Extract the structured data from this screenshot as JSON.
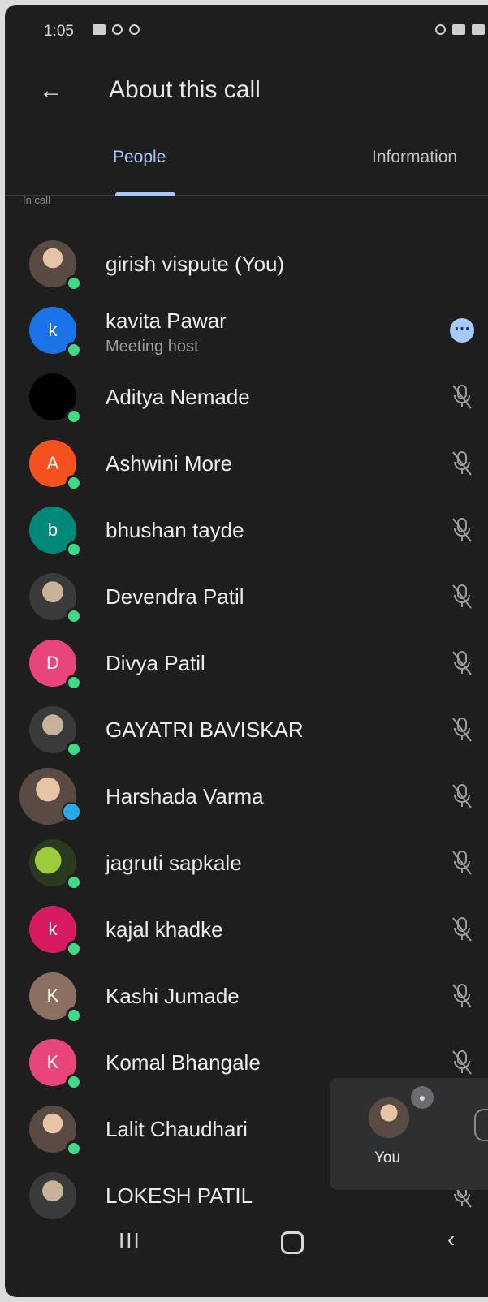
{
  "status_bar": {
    "time": "1:05"
  },
  "app_bar": {
    "back_icon": "arrow-left-icon",
    "title": "About this call"
  },
  "tabs": [
    {
      "label": "People",
      "selected": true
    },
    {
      "label": "Information",
      "selected": false
    }
  ],
  "section_label": "In call",
  "participants": [
    {
      "name": "girish vispute (You)",
      "avatar": "photo",
      "avatar_type": "photo"
    },
    {
      "name": "kavita Pawar",
      "subtitle": "Meeting host",
      "avatar_letter": "k",
      "avatar_color": "#1a73e8",
      "action": "more-options"
    },
    {
      "name": "Aditya Nemade",
      "avatar_color": "#000000",
      "status": "muted"
    },
    {
      "name": "Ashwini More",
      "avatar_letter": "A",
      "avatar_color": "#f4511e",
      "status": "muted"
    },
    {
      "name": "bhushan tayde",
      "avatar_letter": "b",
      "avatar_color": "#00897b",
      "status": "muted"
    },
    {
      "name": "Devendra Patil",
      "avatar_type": "photo",
      "status": "muted"
    },
    {
      "name": "Divya Patil",
      "avatar_letter": "D",
      "avatar_color": "#e8457a",
      "status": "muted"
    },
    {
      "name": "GAYATRI BAVISKAR",
      "avatar_type": "photo",
      "status": "muted"
    },
    {
      "name": "Harshada Varma",
      "avatar_type": "photo",
      "status": "muted"
    },
    {
      "name": "jagruti sapkale",
      "avatar_type": "photo",
      "status": "muted"
    },
    {
      "name": "kajal khadke",
      "avatar_letter": "k",
      "avatar_color": "#d81b60",
      "status": "muted"
    },
    {
      "name": "Kashi Jumade",
      "avatar_letter": "K",
      "avatar_color": "#8d6e63",
      "status": "muted"
    },
    {
      "name": "Komal Bhangale",
      "avatar_letter": "K",
      "avatar_color": "#e8457a",
      "status": "muted"
    },
    {
      "name": "Lalit Chaudhari",
      "avatar_type": "photo"
    },
    {
      "name": "LOKESH PATIL",
      "avatar_type": "photo",
      "status": "muted"
    }
  ],
  "self_tile": {
    "label": "You"
  },
  "nav": {
    "recent_label": "III"
  }
}
